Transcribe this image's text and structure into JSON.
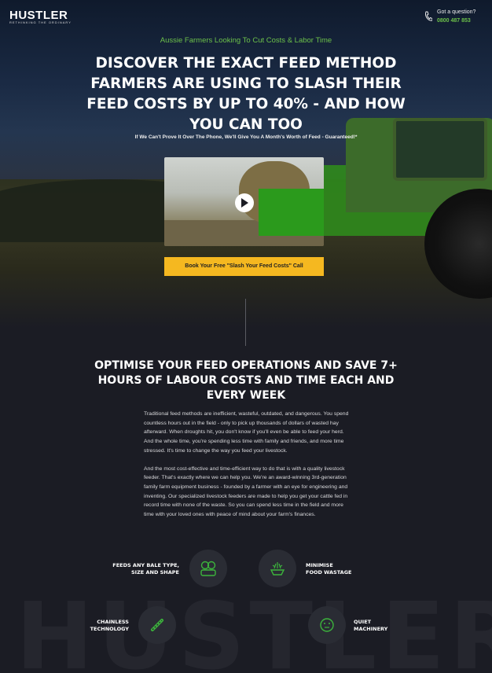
{
  "header": {
    "logo": "HUSTLER",
    "logo_tagline": "RETHINKING THE ORDINARY",
    "phone_question": "Got a question?",
    "phone_number": "0800 487 853"
  },
  "hero": {
    "kicker": "Aussie Farmers Looking To Cut Costs & Labor Time",
    "headline": "DISCOVER THE EXACT FEED METHOD FARMERS ARE USING TO SLASH THEIR FEED COSTS BY UP TO 40% - AND HOW YOU CAN TOO",
    "subline": "If We Can't Prove It Over The Phone, We'll Give You A Month's Worth of Feed - Guaranteed!*",
    "cta_label": "Book Your Free \"Slash Your Feed Costs\" Call"
  },
  "section": {
    "heading": "OPTIMISE YOUR FEED OPERATIONS AND SAVE 7+ HOURS OF LABOUR COSTS AND TIME EACH AND EVERY WEEK",
    "para1": "Traditional feed methods are inefficient, wasteful, outdated, and dangerous. You spend countless hours out in the field - only to pick up thousands of dollars of wasted hay afterward. When droughts hit, you don't know if you'll even be able to feed your herd. And the whole time, you're spending less time with family and friends, and more time stressed. It's time to change the way you feed your livestock.",
    "para2": "And the most cost-effective and time-efficient way to do that is with a quality livestock feeder. That's exactly where we can help you. We're an award-winning 3rd-generation family farm equipment business - founded by a farmer with an eye for engineering and inventing. Our specialized livestock feeders are made to help you get your cattle fed in record time with none of the waste. So you can spend less time in the field and more time with your loved ones with peace of mind about your farm's finances."
  },
  "features": [
    {
      "label_line1": "FEEDS ANY BALE TYPE,",
      "label_line2": "SIZE AND SHAPE",
      "icon": "bale-icon"
    },
    {
      "label_line1": "MINIMISE",
      "label_line2": "FOOD WASTAGE",
      "icon": "waste-icon"
    },
    {
      "label_line1": "CHAINLESS",
      "label_line2": "TECHNOLOGY",
      "icon": "chain-icon"
    },
    {
      "label_line1": "QUIET",
      "label_line2": "MACHINERY",
      "icon": "quiet-icon"
    }
  ],
  "watermark": "HUSTLER",
  "colors": {
    "accent_green": "#6cc04a",
    "cta_yellow": "#f5b820",
    "background": "#1b1c24"
  }
}
